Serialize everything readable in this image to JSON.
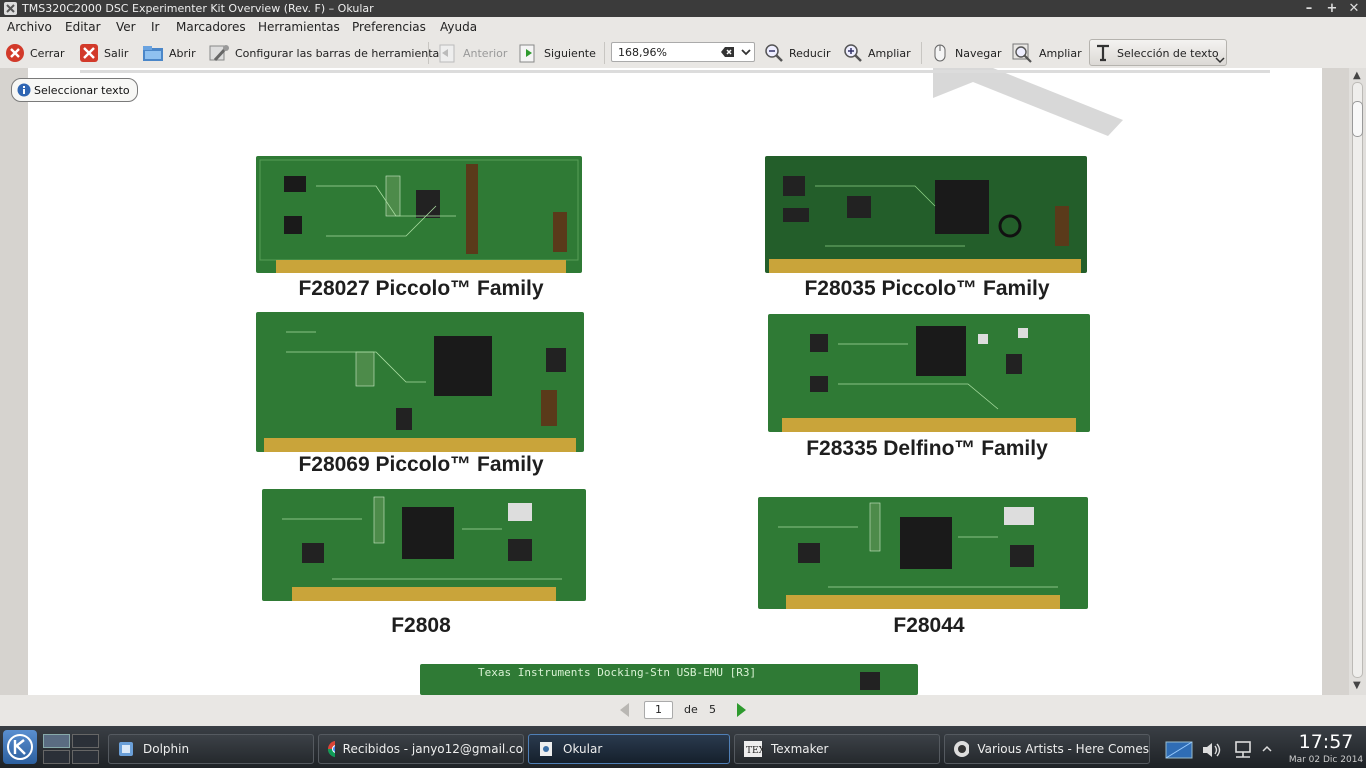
{
  "window": {
    "title": "TMS320C2000 DSC Experimenter Kit Overview (Rev. F) – Okular"
  },
  "menu": [
    "Archivo",
    "Editar",
    "Ver",
    "Ir",
    "Marcadores",
    "Herramientas",
    "Preferencias",
    "Ayuda"
  ],
  "toolbar": {
    "close": "Cerrar",
    "quit": "Salir",
    "open": "Abrir",
    "configure": "Configurar las barras de herramientas",
    "previous": "Anterior",
    "next": "Siguiente",
    "zoom_value": "168,96%",
    "zoom_out": "Reducir",
    "zoom_in": "Ampliar",
    "browse": "Navegar",
    "zoom_tool": "Ampliar",
    "text_selection": "Selección de texto"
  },
  "hint": {
    "text": "Seleccionar texto"
  },
  "document": {
    "boards": [
      {
        "label": "F28027 Piccolo™ Family"
      },
      {
        "label": "F28035 Piccolo™ Family"
      },
      {
        "label": "F28069 Piccolo™ Family"
      },
      {
        "label": "F28335 Delfino™ Family"
      },
      {
        "label": "F2808"
      },
      {
        "label": "F28044"
      }
    ],
    "docking_station_silkscreen": "Texas Instruments   Docking-Stn USB-EMU [R3]"
  },
  "pager": {
    "current": "1",
    "of_label": "de",
    "total": "5"
  },
  "taskbar": {
    "tasks": [
      "Dolphin",
      "Recibidos - janyo12@gmail.co",
      "Okular",
      "Texmaker",
      "Various Artists - Here Comes"
    ],
    "time": "17:57",
    "date": "Mar 02 Dic 2014"
  },
  "colors": {
    "pcb_green": "#2f7a35",
    "gold_pins": "#c9a43a",
    "titlebar": "#3b3b3b",
    "next_arrow": "#2e9a2e"
  }
}
